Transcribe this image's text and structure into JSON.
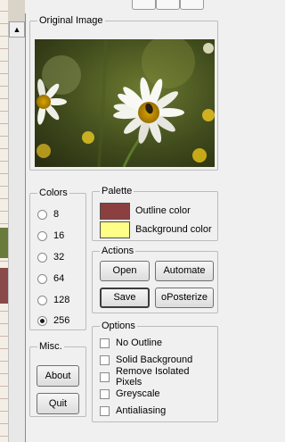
{
  "original_image": {
    "label": "Original Image"
  },
  "colors": {
    "label": "Colors",
    "options": [
      "8",
      "16",
      "32",
      "64",
      "128",
      "256"
    ],
    "selected": "256"
  },
  "palette": {
    "label": "Palette",
    "outline": {
      "label": "Outline color",
      "color": "#8b3f3f"
    },
    "background": {
      "label": "Background color",
      "color": "#ffff88"
    }
  },
  "actions": {
    "label": "Actions",
    "open": "Open",
    "automate": "Automate",
    "save": "Save",
    "posterize": "oPosterize"
  },
  "misc": {
    "label": "Misc.",
    "about": "About",
    "quit": "Quit"
  },
  "options": {
    "label": "Options",
    "items": [
      "No Outline",
      "Solid Background",
      "Remove Isolated Pixels",
      "Greyscale",
      "Antialiasing"
    ]
  },
  "scrollbar": {
    "up_arrow": "▲"
  }
}
